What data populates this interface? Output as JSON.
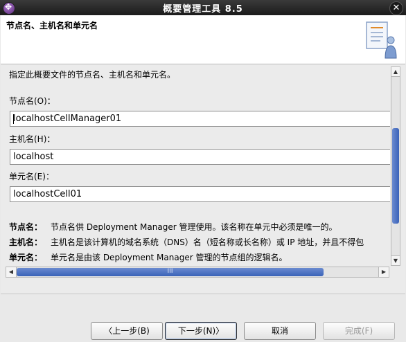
{
  "window": {
    "title": "概要管理工具 8.5",
    "close_label": "✕"
  },
  "header": {
    "title": "节点名、主机名和单元名"
  },
  "content": {
    "description": "指定此概要文件的节点名、主机名和单元名。",
    "fields": [
      {
        "label": "节点名(O)：",
        "value": "localhostCellManager01"
      },
      {
        "label": "主机名(H)：",
        "value": "localhost"
      },
      {
        "label": "单元名(E)：",
        "value": "localhostCell01"
      }
    ],
    "help": [
      {
        "term": "节点名：",
        "text": "节点名供 Deployment Manager 管理使用。该名称在单元中必须是唯一的。"
      },
      {
        "term": "主机名：",
        "text": "主机名是该计算机的域名系统（DNS）名（短名称或长名称）或 IP 地址，并且不得包"
      },
      {
        "term": "单元名：",
        "text": "单元名是由该 Deployment Manager 管理的节点组的逻辑名。"
      }
    ]
  },
  "scrollbar": {
    "grip": "III"
  },
  "buttons": {
    "back": "〈上一步(B)",
    "next": "下一步(N)〉",
    "cancel": "取消",
    "finish": "完成(F)"
  },
  "colors": {
    "titlebar": "#1b1b1b",
    "scroll_thumb": "#4a6fc0"
  }
}
